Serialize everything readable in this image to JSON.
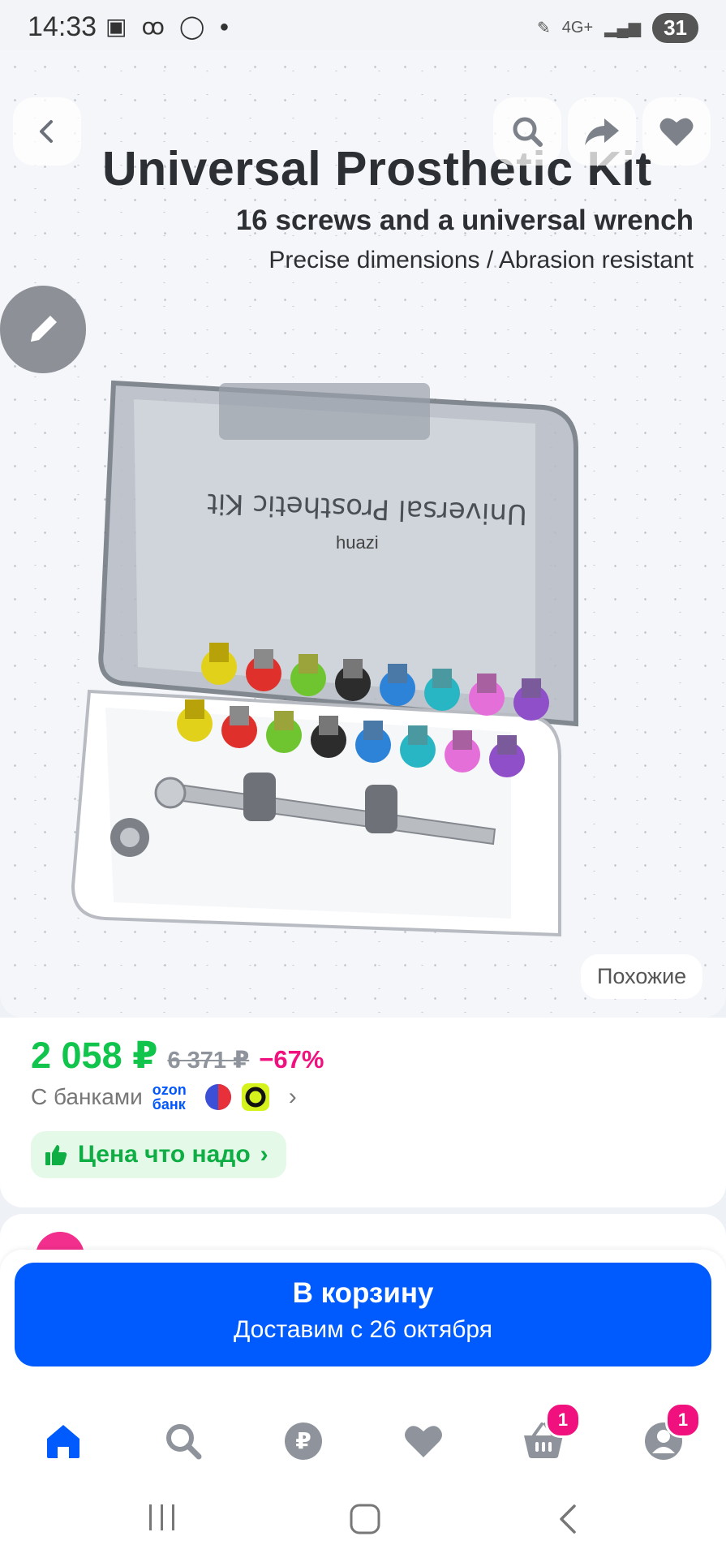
{
  "status_bar": {
    "time": "14:33",
    "network": "4G+",
    "battery": "31"
  },
  "product_image": {
    "title": "Universal Prosthetic Kit",
    "subtitle": "16 screws and a universal wrench",
    "features": "Precise dimensions / Abrasion resistant",
    "watermark": "huazi",
    "similar_label": "Похожие"
  },
  "price": {
    "current": "2 058 ₽",
    "old": "6 371 ₽",
    "discount": "−67%",
    "banks_label": "С банками",
    "ozon_bank_logo": "ozon банк",
    "deal_label": "Цена что надо"
  },
  "cart": {
    "button_label": "В корзину",
    "delivery": "Доставим с 26 октября"
  },
  "bottom_nav": {
    "items": [
      {
        "icon": "home-icon",
        "active": true
      },
      {
        "icon": "search-icon"
      },
      {
        "icon": "ruble-icon"
      },
      {
        "icon": "heart-icon"
      },
      {
        "icon": "basket-icon",
        "badge": "1"
      },
      {
        "icon": "profile-icon",
        "badge": "1"
      }
    ]
  },
  "colors": {
    "brand_blue": "#005bff",
    "price_green": "#10c44c",
    "discount_pink": "#f1117e",
    "icon_gray": "#8e939c"
  }
}
